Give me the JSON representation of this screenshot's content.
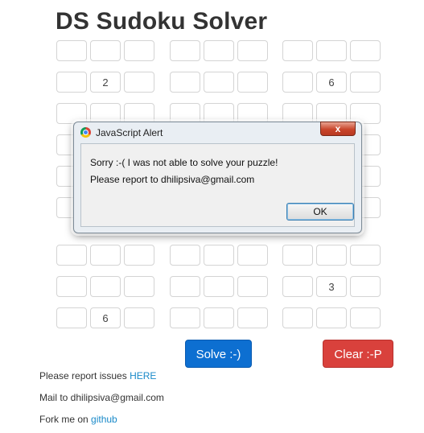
{
  "page": {
    "title": "DS Sudoku Solver"
  },
  "grid": {
    "values": {
      "1-1": "2",
      "1-7": "6",
      "7-7": "3",
      "8-1": "6"
    }
  },
  "buttons": {
    "solve_label": "Solve :-)",
    "clear_label": "Clear :-P"
  },
  "footer": {
    "report_text": "Please report issues ",
    "report_link": "HERE",
    "mail_text": "Mail to dhilipsiva@gmail.com",
    "fork_text": "Fork me on ",
    "fork_link": "github"
  },
  "dialog": {
    "title": "JavaScript Alert",
    "close_label": "x",
    "line1": "Sorry :-( I was not able to solve your puzzle!",
    "line2": "Please report to dhilipsiva@gmail.com",
    "ok_label": "OK"
  },
  "colors": {
    "solve_button": "#0d6fd1",
    "clear_button": "#d9413c",
    "link": "#1a8ac9"
  }
}
